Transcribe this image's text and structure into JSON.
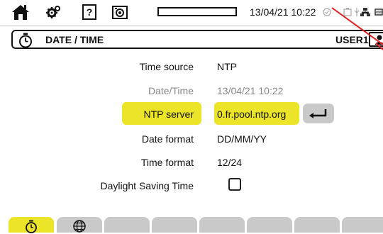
{
  "topbar": {
    "home_icon": "home-icon",
    "settings_icon": "gears-icon",
    "help_label": "?",
    "camera_icon": "camera-icon",
    "datetime": "13/04/21 10:22",
    "status_icons": [
      "status-icon",
      "battery-icon",
      "network-icon",
      "storage-icon"
    ]
  },
  "header": {
    "title": "DATE / TIME",
    "user": "USER1"
  },
  "form": {
    "time_source": {
      "label": "Time source",
      "value": "NTP"
    },
    "date_time": {
      "label": "Date/Time",
      "value": "13/04/21 10:22"
    },
    "ntp_server": {
      "label": "NTP server",
      "value": "0.fr.pool.ntp.org"
    },
    "date_format": {
      "label": "Date format",
      "value": "DD/MM/YY"
    },
    "time_format": {
      "label": "Time format",
      "value": "12/24"
    },
    "dst": {
      "label": "Daylight Saving Time",
      "checked": false
    }
  },
  "tabs": [
    "clock-icon",
    "globe-icon",
    "",
    "",
    "",
    "",
    "",
    ""
  ],
  "colors": {
    "highlight": "#ece428",
    "disabled": "#888888",
    "tab": "#c9c9c9",
    "annotation": "#e02020"
  }
}
